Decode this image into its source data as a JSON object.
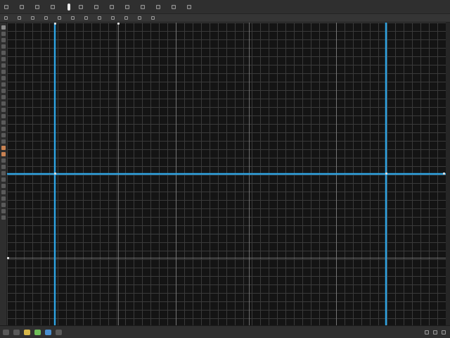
{
  "menubar": {
    "items": [
      {
        "icon": "file-icon",
        "label": ""
      },
      {
        "icon": "edit-icon",
        "label": ""
      },
      {
        "icon": "view-icon",
        "label": ""
      },
      {
        "icon": "layer-icon",
        "label": ""
      },
      {
        "icon": "document-icon",
        "label": ""
      },
      {
        "icon": "object-icon",
        "label": ""
      },
      {
        "icon": "text-icon",
        "label": ""
      },
      {
        "icon": "select-icon",
        "label": ""
      },
      {
        "icon": "effects-icon",
        "label": ""
      },
      {
        "icon": "window-icon",
        "label": ""
      },
      {
        "icon": "help-icon",
        "label": ""
      },
      {
        "icon": "settings-icon",
        "label": ""
      }
    ]
  },
  "toolbar": {
    "items": [
      {
        "icon": "new-icon",
        "label": ""
      },
      {
        "icon": "open-icon",
        "label": ""
      },
      {
        "icon": "save-icon",
        "label": ""
      },
      {
        "icon": "undo-icon",
        "label": ""
      },
      {
        "icon": "redo-icon",
        "label": ""
      },
      {
        "icon": "zoom-icon",
        "label": ""
      },
      {
        "icon": "snap-icon",
        "label": ""
      },
      {
        "icon": "align-icon",
        "label": ""
      },
      {
        "icon": "distribute-icon",
        "label": ""
      },
      {
        "icon": "grid-icon",
        "label": ""
      },
      {
        "icon": "guide-icon",
        "label": ""
      },
      {
        "icon": "export-icon",
        "label": ""
      }
    ]
  },
  "canvas": {
    "grid_color": "#3a3a3a",
    "major_grid_color": "#8a8a8a",
    "guide_color": "#2ea6e6",
    "background": "#141414"
  },
  "statusbar": {
    "left_items": [
      "start-icon",
      "search-icon",
      "folder-icon",
      "browser-icon",
      "app-icon",
      "app-icon-2"
    ],
    "right_text": ""
  },
  "colors": {
    "accent": "#2ea6e6",
    "chrome": "#2f2f2f",
    "canvas": "#141414"
  }
}
